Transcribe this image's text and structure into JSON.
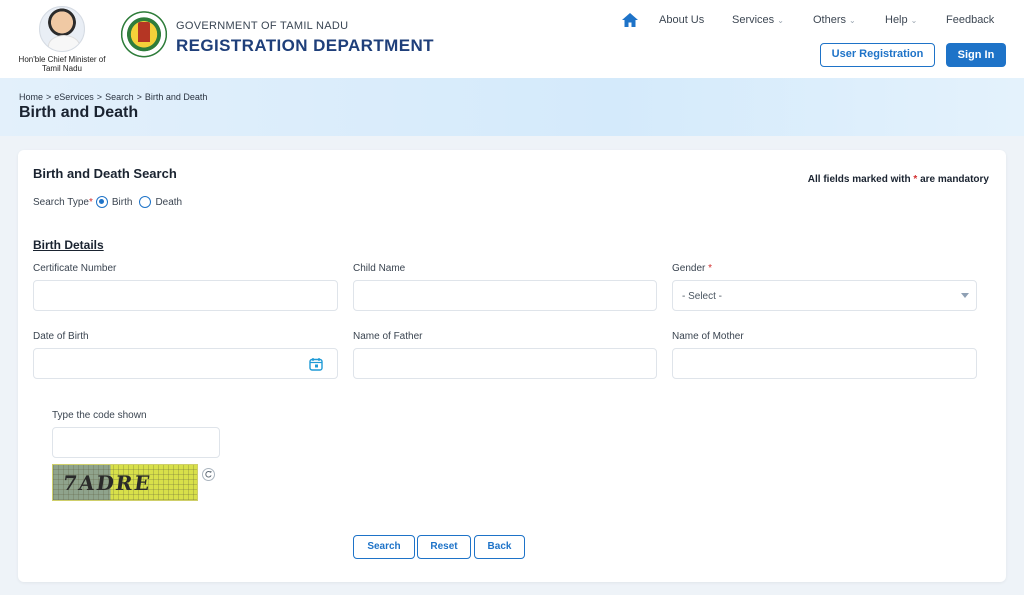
{
  "header": {
    "cm_caption": "Hon'ble Chief Minister of Tamil Nadu",
    "gov_title": "GOVERNMENT OF TAMIL NADU",
    "dept_title": "REGISTRATION DEPARTMENT"
  },
  "nav": {
    "home_icon": "home-icon",
    "items": [
      "About Us",
      "Services",
      "Others",
      "Help",
      "Feedback"
    ]
  },
  "auth": {
    "user_registration": "User Registration",
    "sign_in": "Sign In"
  },
  "breadcrumb": [
    "Home",
    "eServices",
    "Search",
    "Birth and Death"
  ],
  "breadcrumb_separator": ">",
  "page_title": "Birth and Death",
  "form": {
    "title": "Birth and Death Search",
    "mandatory_note_prefix": "All fields marked with",
    "mandatory_star": "*",
    "mandatory_note_suffix": "are mandatory",
    "search_type_label": "Search Type",
    "search_type_options": [
      "Birth",
      "Death"
    ],
    "search_type_selected": "Birth",
    "section_title": "Birth Details",
    "fields": {
      "certificate_number": {
        "label": "Certificate Number",
        "value": ""
      },
      "child_name": {
        "label": "Child Name",
        "value": ""
      },
      "gender": {
        "label": "Gender",
        "selected": "- Select -"
      },
      "date_of_birth": {
        "label": "Date of Birth",
        "value": ""
      },
      "father_name": {
        "label": "Name of Father",
        "value": ""
      },
      "mother_name": {
        "label": "Name of Mother",
        "value": ""
      },
      "captcha": {
        "label": "Type the code shown",
        "value": "",
        "image_text": "7ADRE"
      }
    },
    "buttons": {
      "search": "Search",
      "reset": "Reset",
      "back": "Back"
    }
  },
  "colors": {
    "accent": "#1e73c8",
    "dept_title": "#1f3f7a",
    "required": "#d32f2f"
  }
}
